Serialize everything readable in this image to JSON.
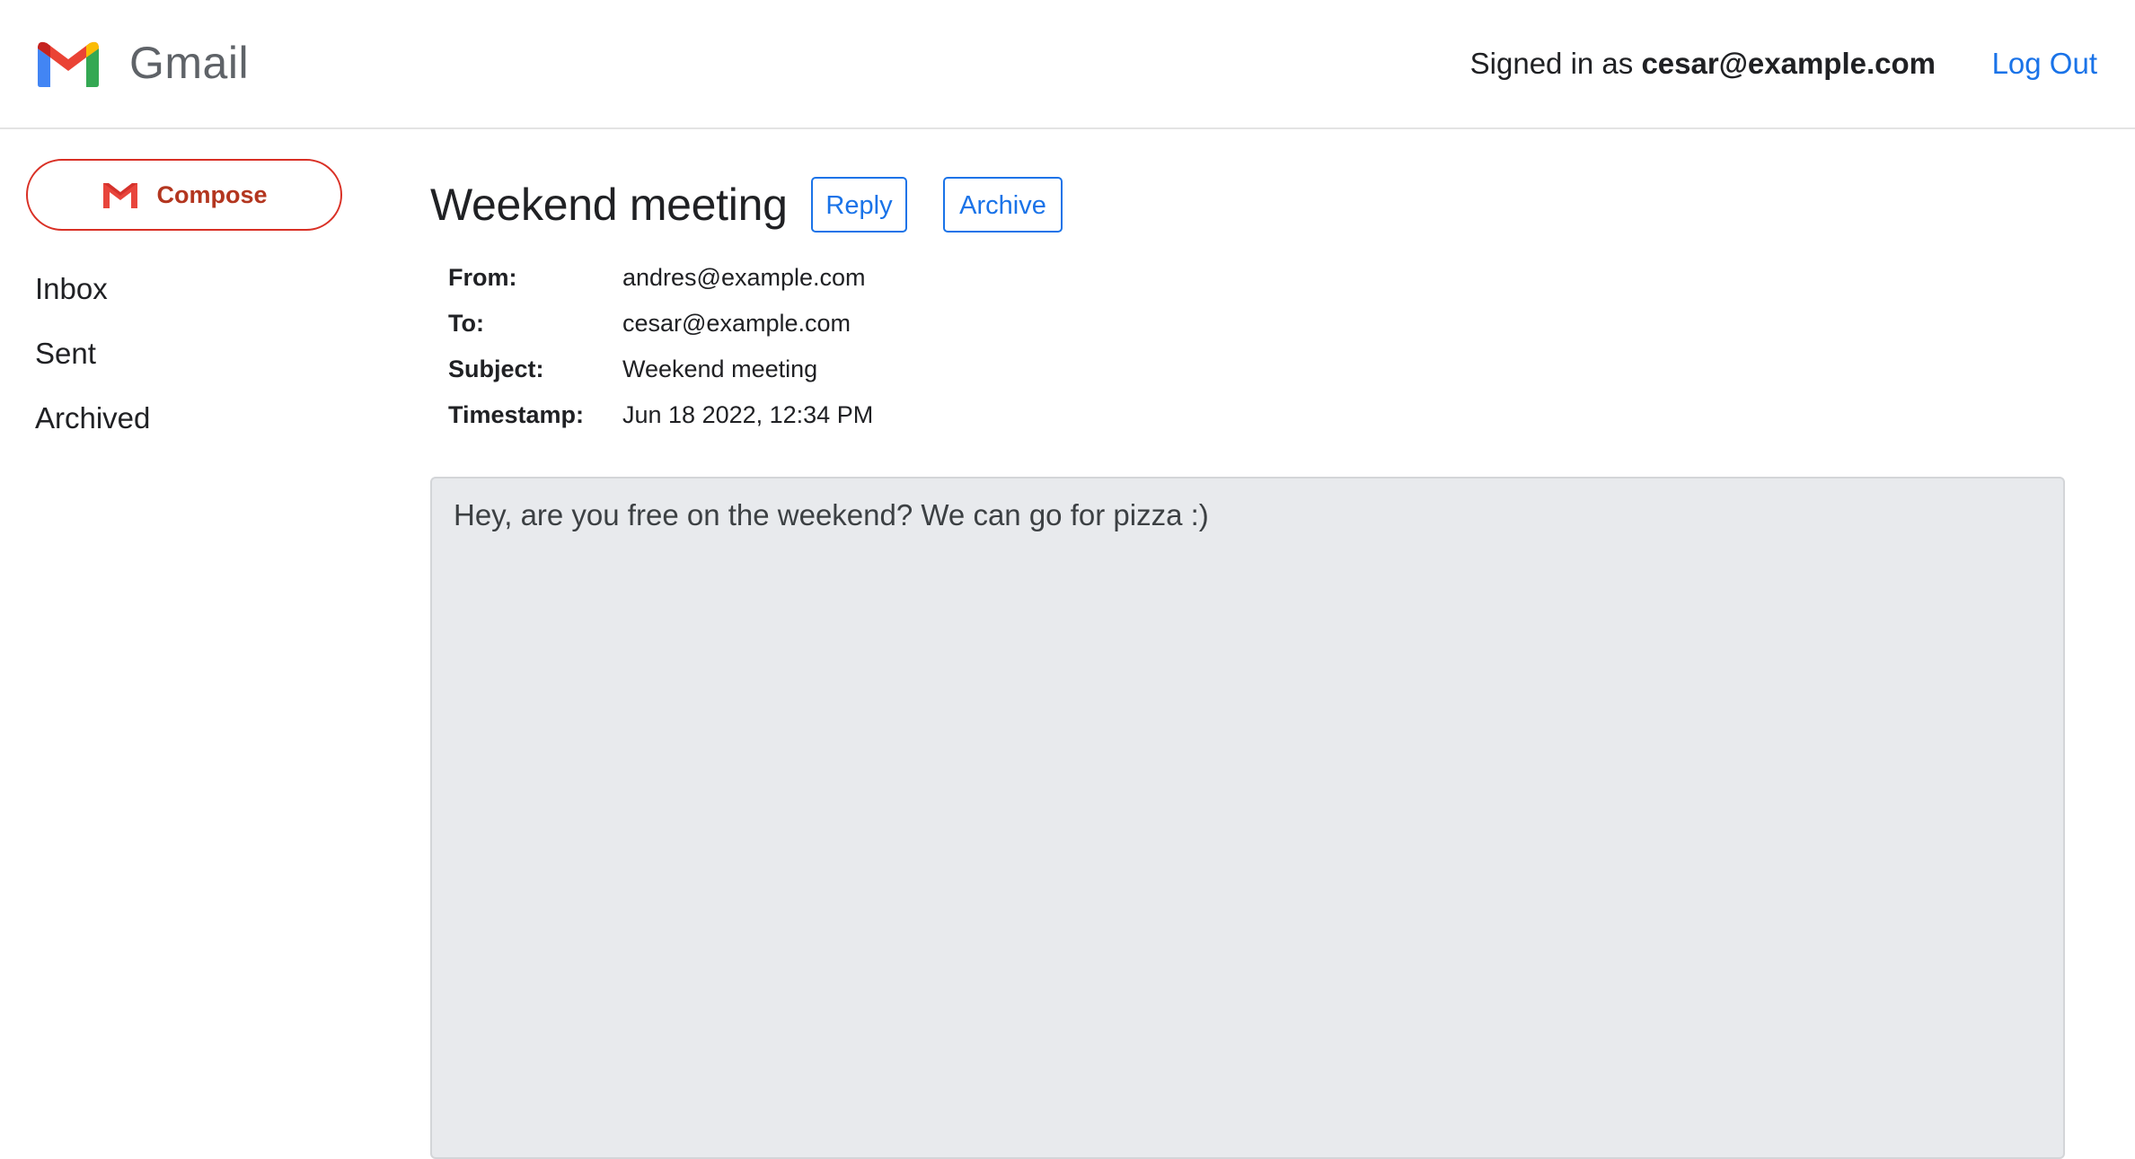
{
  "header": {
    "brand": "Gmail",
    "signed_in_prefix": "Signed in as ",
    "signed_in_email": "cesar@example.com",
    "logout_label": "Log Out"
  },
  "sidebar": {
    "compose_label": "Compose",
    "items": [
      {
        "label": "Inbox"
      },
      {
        "label": "Sent"
      },
      {
        "label": "Archived"
      }
    ]
  },
  "email": {
    "title": "Weekend meeting",
    "reply_label": "Reply",
    "archive_label": "Archive",
    "fields": [
      {
        "label": "From:",
        "value": "andres@example.com"
      },
      {
        "label": "To:",
        "value": "cesar@example.com"
      },
      {
        "label": "Subject:",
        "value": "Weekend meeting"
      },
      {
        "label": "Timestamp:",
        "value": "Jun 18 2022, 12:34 PM"
      }
    ],
    "body": "Hey, are you free on the weekend? We can go for pizza :)"
  },
  "colors": {
    "accent_blue": "#1a73e8",
    "compose_red": "#d93025",
    "body_bg": "#e8eaed"
  },
  "icons": {
    "logo": "gmail-logo-icon",
    "compose": "gmail-m-icon"
  }
}
